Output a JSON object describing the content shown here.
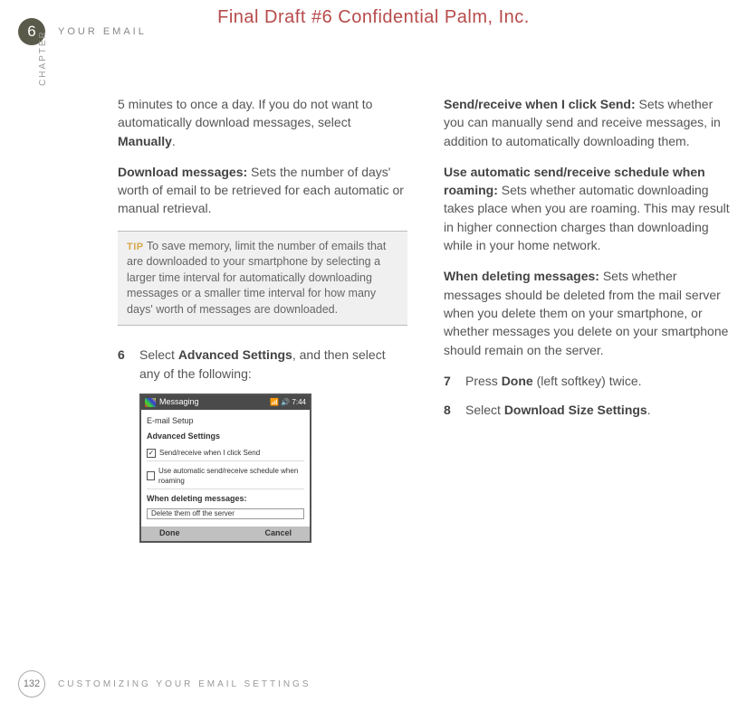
{
  "watermark": "Final Draft #6     Confidential     Palm, Inc.",
  "header": {
    "chapter_num": "6",
    "title": "YOUR EMAIL",
    "side_label": "CHAPTER"
  },
  "left": {
    "intro": "5 minutes to once a day. If you do not want to automatically download messages, select ",
    "intro_bold": "Manually",
    "intro_end": ".",
    "dl_bold": "Download messages:",
    "dl_text": " Sets the number of days' worth of email to be retrieved for each automatic or manual retrieval.",
    "tip_label": "TIP",
    "tip_text": " To save memory, limit the number of emails that are downloaded to your smartphone by selecting a larger time interval for automatically downloading messages or a smaller time interval for how many days' worth of messages are downloaded.",
    "step6_num": "6",
    "step6_a": "Select ",
    "step6_bold": "Advanced Settings",
    "step6_b": ", and then select any of the following:"
  },
  "screenshot": {
    "app": "Messaging",
    "time": "7:44",
    "section": "E-mail Setup",
    "heading": "Advanced Settings",
    "opt1": "Send/receive when I click Send",
    "opt2": "Use automatic send/receive schedule when roaming",
    "heading2": "When deleting messages:",
    "dropdown": "Delete them off the server",
    "left_soft": "Done",
    "right_soft": "Cancel"
  },
  "right": {
    "sr_bold": "Send/receive when I click Send:",
    "sr_text": " Sets whether you can manually send and receive messages, in addition to automatically downloading them.",
    "roam_bold": "Use automatic send/receive schedule when roaming:",
    "roam_text": " Sets whether automatic downloading takes place when you are roaming. This may result in higher connection charges than downloading while in your home network.",
    "del_bold": "When deleting messages:",
    "del_text": " Sets whether messages should be deleted from the mail server when you delete them on your smartphone, or whether messages you delete on your smartphone should remain on the server.",
    "step7_num": "7",
    "step7_a": "Press ",
    "step7_bold": "Done",
    "step7_b": " (left softkey) twice.",
    "step8_num": "8",
    "step8_a": "Select ",
    "step8_bold": "Download Size Settings",
    "step8_b": "."
  },
  "footer": {
    "page": "132",
    "title": "CUSTOMIZING YOUR EMAIL SETTINGS"
  }
}
